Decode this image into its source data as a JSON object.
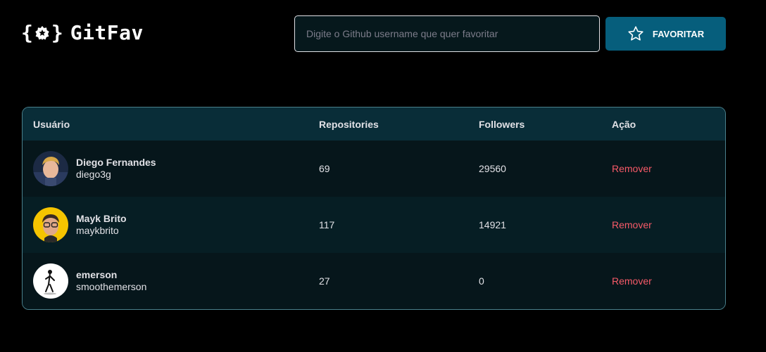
{
  "header": {
    "logo_text": "GitFav",
    "logo_brace_open": "{",
    "logo_brace_close": "}",
    "search_placeholder": "Digite o Github username que quer favoritar",
    "search_value": "",
    "favorite_button_label": "FAVORITAR"
  },
  "table": {
    "columns": [
      "Usuário",
      "Repositories",
      "Followers",
      "Ação"
    ],
    "rows": [
      {
        "name": "Diego Fernandes",
        "login": "diego3g",
        "repositories": "69",
        "followers": "29560",
        "action": "Remover"
      },
      {
        "name": "Mayk Brito",
        "login": "maykbrito",
        "repositories": "117",
        "followers": "14921",
        "action": "Remover"
      },
      {
        "name": "emerson",
        "login": "smoothemerson",
        "repositories": "27",
        "followers": "0",
        "action": "Remover"
      }
    ]
  },
  "colors": {
    "background": "#000000",
    "button": "#065e7c",
    "table_header": "#092d38",
    "remove": "#f75a68",
    "border": "#4a808c"
  }
}
